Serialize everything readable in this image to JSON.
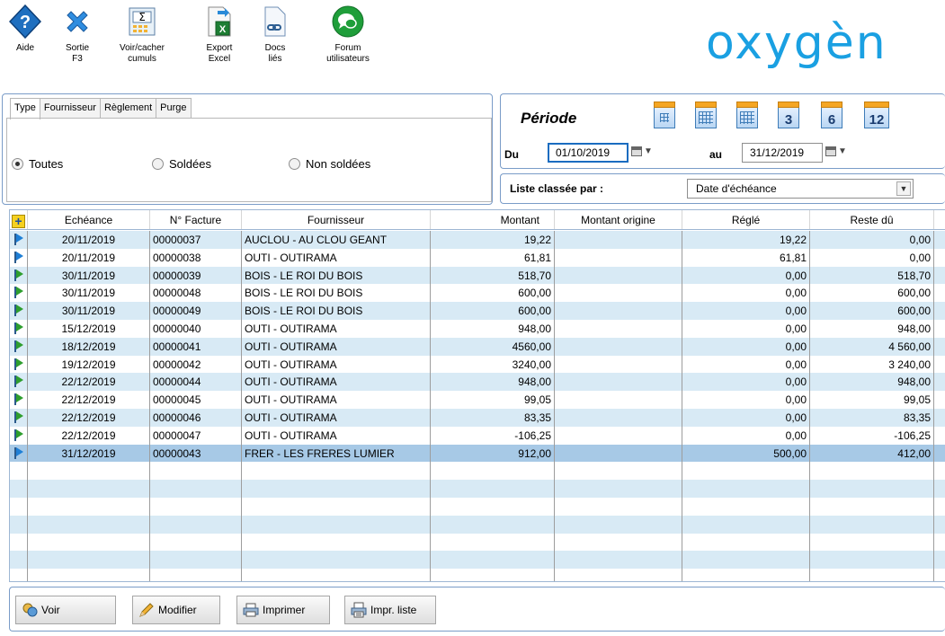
{
  "toolbar": {
    "buttons": [
      {
        "id": "aide",
        "label": "Aide",
        "icon": "help-icon"
      },
      {
        "id": "sortie",
        "label": "Sortie\nF3",
        "icon": "exit-icon"
      },
      {
        "id": "cumuls",
        "label": "Voir/cacher\ncumuls",
        "icon": "sigma-icon"
      },
      {
        "id": "excel",
        "label": "Export\nExcel",
        "icon": "excel-icon"
      },
      {
        "id": "docs",
        "label": "Docs\nliés",
        "icon": "linked-docs-icon"
      },
      {
        "id": "forum",
        "label": "Forum\nutilisateurs",
        "icon": "forum-icon"
      }
    ],
    "logo": "oxygèn"
  },
  "filter": {
    "tabs": [
      "Type",
      "Fournisseur",
      "Règlement",
      "Purge"
    ],
    "active_tab": "Type",
    "radios": [
      {
        "label": "Toutes",
        "checked": true
      },
      {
        "label": "Soldées",
        "checked": false
      },
      {
        "label": "Non soldées",
        "checked": false
      }
    ]
  },
  "period": {
    "title": "Période",
    "du_label": "Du",
    "du_value": "01/10/2019",
    "au_label": "au",
    "au_value": "31/12/2019",
    "shortcuts": [
      "",
      "",
      "",
      "3",
      "6",
      "12"
    ]
  },
  "sort": {
    "label": "Liste classée par :",
    "value": "Date d'échéance"
  },
  "grid": {
    "columns": [
      "",
      "Echéance",
      "N° Facture",
      "Fournisseur",
      "Montant",
      "Montant origine",
      "Réglé",
      "Reste dû"
    ],
    "rows": [
      {
        "flag": "blue",
        "echeance": "20/11/2019",
        "facture": "00000037",
        "fournisseur": "AUCLOU - AU CLOU GEANT",
        "montant": "19,22",
        "origine": "",
        "regle": "19,22",
        "reste": "0,00"
      },
      {
        "flag": "blue",
        "echeance": "20/11/2019",
        "facture": "00000038",
        "fournisseur": "OUTI - OUTIRAMA",
        "montant": "61,81",
        "origine": "",
        "regle": "61,81",
        "reste": "0,00"
      },
      {
        "flag": "green",
        "echeance": "30/11/2019",
        "facture": "00000039",
        "fournisseur": "BOIS - LE ROI DU BOIS",
        "montant": "518,70",
        "origine": "",
        "regle": "0,00",
        "reste": "518,70"
      },
      {
        "flag": "green",
        "echeance": "30/11/2019",
        "facture": "00000048",
        "fournisseur": "BOIS - LE ROI DU BOIS",
        "montant": "600,00",
        "origine": "",
        "regle": "0,00",
        "reste": "600,00"
      },
      {
        "flag": "green",
        "echeance": "30/11/2019",
        "facture": "00000049",
        "fournisseur": "BOIS - LE ROI DU BOIS",
        "montant": "600,00",
        "origine": "",
        "regle": "0,00",
        "reste": "600,00"
      },
      {
        "flag": "green",
        "echeance": "15/12/2019",
        "facture": "00000040",
        "fournisseur": "OUTI - OUTIRAMA",
        "montant": "948,00",
        "origine": "",
        "regle": "0,00",
        "reste": "948,00"
      },
      {
        "flag": "green",
        "echeance": "18/12/2019",
        "facture": "00000041",
        "fournisseur": "OUTI - OUTIRAMA",
        "montant": "4560,00",
        "origine": "",
        "regle": "0,00",
        "reste": "4 560,00"
      },
      {
        "flag": "green",
        "echeance": "19/12/2019",
        "facture": "00000042",
        "fournisseur": "OUTI - OUTIRAMA",
        "montant": "3240,00",
        "origine": "",
        "regle": "0,00",
        "reste": "3 240,00"
      },
      {
        "flag": "green",
        "echeance": "22/12/2019",
        "facture": "00000044",
        "fournisseur": "OUTI - OUTIRAMA",
        "montant": "948,00",
        "origine": "",
        "regle": "0,00",
        "reste": "948,00"
      },
      {
        "flag": "green",
        "echeance": "22/12/2019",
        "facture": "00000045",
        "fournisseur": "OUTI - OUTIRAMA",
        "montant": "99,05",
        "origine": "",
        "regle": "0,00",
        "reste": "99,05"
      },
      {
        "flag": "green",
        "echeance": "22/12/2019",
        "facture": "00000046",
        "fournisseur": "OUTI - OUTIRAMA",
        "montant": "83,35",
        "origine": "",
        "regle": "0,00",
        "reste": "83,35"
      },
      {
        "flag": "green",
        "echeance": "22/12/2019",
        "facture": "00000047",
        "fournisseur": "OUTI - OUTIRAMA",
        "montant": "-106,25",
        "origine": "",
        "regle": "0,00",
        "reste": "-106,25"
      },
      {
        "flag": "blue",
        "echeance": "31/12/2019",
        "facture": "00000043",
        "fournisseur": "FRER - LES FRERES LUMIER",
        "montant": "912,00",
        "origine": "",
        "regle": "500,00",
        "reste": "412,00",
        "selected": true
      }
    ]
  },
  "actions": {
    "voir": "Voir",
    "modifier": "Modifier",
    "imprimer": "Imprimer",
    "impr_liste": "Impr. liste"
  },
  "colors": {
    "row_alt": "#d8eaf5",
    "row_selected": "#a7c9e6",
    "logo": "#1aa0e2",
    "panel_border": "#7a9cc8"
  }
}
